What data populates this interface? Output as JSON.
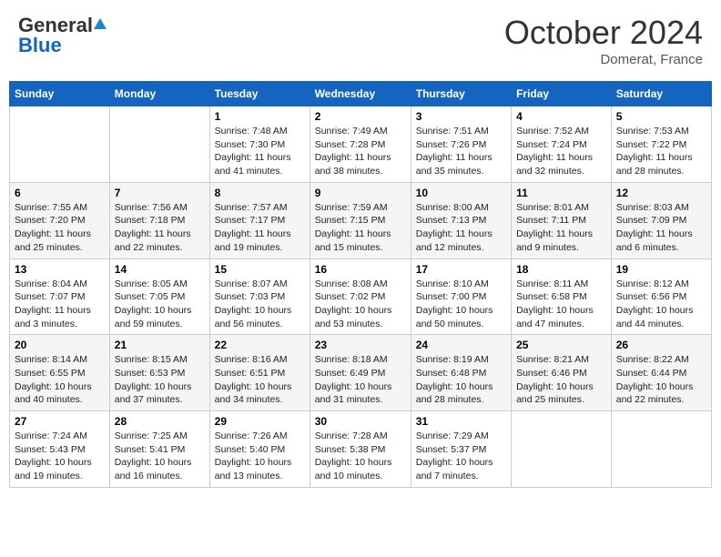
{
  "header": {
    "logo_general": "General",
    "logo_blue": "Blue",
    "month_title": "October 2024",
    "location": "Domerat, France"
  },
  "weekdays": [
    "Sunday",
    "Monday",
    "Tuesday",
    "Wednesday",
    "Thursday",
    "Friday",
    "Saturday"
  ],
  "weeks": [
    [
      {
        "day": "",
        "sunrise": "",
        "sunset": "",
        "daylight": ""
      },
      {
        "day": "",
        "sunrise": "",
        "sunset": "",
        "daylight": ""
      },
      {
        "day": "1",
        "sunrise": "Sunrise: 7:48 AM",
        "sunset": "Sunset: 7:30 PM",
        "daylight": "Daylight: 11 hours and 41 minutes."
      },
      {
        "day": "2",
        "sunrise": "Sunrise: 7:49 AM",
        "sunset": "Sunset: 7:28 PM",
        "daylight": "Daylight: 11 hours and 38 minutes."
      },
      {
        "day": "3",
        "sunrise": "Sunrise: 7:51 AM",
        "sunset": "Sunset: 7:26 PM",
        "daylight": "Daylight: 11 hours and 35 minutes."
      },
      {
        "day": "4",
        "sunrise": "Sunrise: 7:52 AM",
        "sunset": "Sunset: 7:24 PM",
        "daylight": "Daylight: 11 hours and 32 minutes."
      },
      {
        "day": "5",
        "sunrise": "Sunrise: 7:53 AM",
        "sunset": "Sunset: 7:22 PM",
        "daylight": "Daylight: 11 hours and 28 minutes."
      }
    ],
    [
      {
        "day": "6",
        "sunrise": "Sunrise: 7:55 AM",
        "sunset": "Sunset: 7:20 PM",
        "daylight": "Daylight: 11 hours and 25 minutes."
      },
      {
        "day": "7",
        "sunrise": "Sunrise: 7:56 AM",
        "sunset": "Sunset: 7:18 PM",
        "daylight": "Daylight: 11 hours and 22 minutes."
      },
      {
        "day": "8",
        "sunrise": "Sunrise: 7:57 AM",
        "sunset": "Sunset: 7:17 PM",
        "daylight": "Daylight: 11 hours and 19 minutes."
      },
      {
        "day": "9",
        "sunrise": "Sunrise: 7:59 AM",
        "sunset": "Sunset: 7:15 PM",
        "daylight": "Daylight: 11 hours and 15 minutes."
      },
      {
        "day": "10",
        "sunrise": "Sunrise: 8:00 AM",
        "sunset": "Sunset: 7:13 PM",
        "daylight": "Daylight: 11 hours and 12 minutes."
      },
      {
        "day": "11",
        "sunrise": "Sunrise: 8:01 AM",
        "sunset": "Sunset: 7:11 PM",
        "daylight": "Daylight: 11 hours and 9 minutes."
      },
      {
        "day": "12",
        "sunrise": "Sunrise: 8:03 AM",
        "sunset": "Sunset: 7:09 PM",
        "daylight": "Daylight: 11 hours and 6 minutes."
      }
    ],
    [
      {
        "day": "13",
        "sunrise": "Sunrise: 8:04 AM",
        "sunset": "Sunset: 7:07 PM",
        "daylight": "Daylight: 11 hours and 3 minutes."
      },
      {
        "day": "14",
        "sunrise": "Sunrise: 8:05 AM",
        "sunset": "Sunset: 7:05 PM",
        "daylight": "Daylight: 10 hours and 59 minutes."
      },
      {
        "day": "15",
        "sunrise": "Sunrise: 8:07 AM",
        "sunset": "Sunset: 7:03 PM",
        "daylight": "Daylight: 10 hours and 56 minutes."
      },
      {
        "day": "16",
        "sunrise": "Sunrise: 8:08 AM",
        "sunset": "Sunset: 7:02 PM",
        "daylight": "Daylight: 10 hours and 53 minutes."
      },
      {
        "day": "17",
        "sunrise": "Sunrise: 8:10 AM",
        "sunset": "Sunset: 7:00 PM",
        "daylight": "Daylight: 10 hours and 50 minutes."
      },
      {
        "day": "18",
        "sunrise": "Sunrise: 8:11 AM",
        "sunset": "Sunset: 6:58 PM",
        "daylight": "Daylight: 10 hours and 47 minutes."
      },
      {
        "day": "19",
        "sunrise": "Sunrise: 8:12 AM",
        "sunset": "Sunset: 6:56 PM",
        "daylight": "Daylight: 10 hours and 44 minutes."
      }
    ],
    [
      {
        "day": "20",
        "sunrise": "Sunrise: 8:14 AM",
        "sunset": "Sunset: 6:55 PM",
        "daylight": "Daylight: 10 hours and 40 minutes."
      },
      {
        "day": "21",
        "sunrise": "Sunrise: 8:15 AM",
        "sunset": "Sunset: 6:53 PM",
        "daylight": "Daylight: 10 hours and 37 minutes."
      },
      {
        "day": "22",
        "sunrise": "Sunrise: 8:16 AM",
        "sunset": "Sunset: 6:51 PM",
        "daylight": "Daylight: 10 hours and 34 minutes."
      },
      {
        "day": "23",
        "sunrise": "Sunrise: 8:18 AM",
        "sunset": "Sunset: 6:49 PM",
        "daylight": "Daylight: 10 hours and 31 minutes."
      },
      {
        "day": "24",
        "sunrise": "Sunrise: 8:19 AM",
        "sunset": "Sunset: 6:48 PM",
        "daylight": "Daylight: 10 hours and 28 minutes."
      },
      {
        "day": "25",
        "sunrise": "Sunrise: 8:21 AM",
        "sunset": "Sunset: 6:46 PM",
        "daylight": "Daylight: 10 hours and 25 minutes."
      },
      {
        "day": "26",
        "sunrise": "Sunrise: 8:22 AM",
        "sunset": "Sunset: 6:44 PM",
        "daylight": "Daylight: 10 hours and 22 minutes."
      }
    ],
    [
      {
        "day": "27",
        "sunrise": "Sunrise: 7:24 AM",
        "sunset": "Sunset: 5:43 PM",
        "daylight": "Daylight: 10 hours and 19 minutes."
      },
      {
        "day": "28",
        "sunrise": "Sunrise: 7:25 AM",
        "sunset": "Sunset: 5:41 PM",
        "daylight": "Daylight: 10 hours and 16 minutes."
      },
      {
        "day": "29",
        "sunrise": "Sunrise: 7:26 AM",
        "sunset": "Sunset: 5:40 PM",
        "daylight": "Daylight: 10 hours and 13 minutes."
      },
      {
        "day": "30",
        "sunrise": "Sunrise: 7:28 AM",
        "sunset": "Sunset: 5:38 PM",
        "daylight": "Daylight: 10 hours and 10 minutes."
      },
      {
        "day": "31",
        "sunrise": "Sunrise: 7:29 AM",
        "sunset": "Sunset: 5:37 PM",
        "daylight": "Daylight: 10 hours and 7 minutes."
      },
      {
        "day": "",
        "sunrise": "",
        "sunset": "",
        "daylight": ""
      },
      {
        "day": "",
        "sunrise": "",
        "sunset": "",
        "daylight": ""
      }
    ]
  ]
}
